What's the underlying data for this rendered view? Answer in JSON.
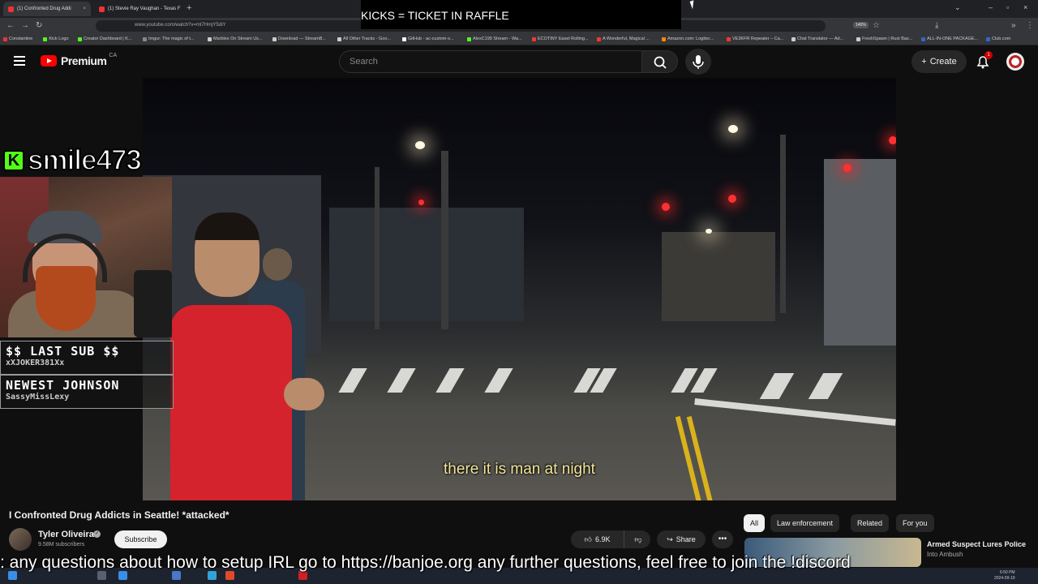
{
  "browser": {
    "tabs": [
      {
        "label": "(1) Confronted Drug Addi",
        "active": true
      },
      {
        "label": "(1) Stevie Ray Vaughan - Texas F",
        "active": false
      }
    ],
    "new_tab_glyph": "+",
    "url": "www.youtube.com/watch?v=mt7HmjY5diY",
    "zoom": "140%",
    "bookmarks": [
      "Constantine",
      "Kick Logo",
      "Creator Dashboard | K...",
      "Imgur: The magic of t...",
      "Marbles On Stream Us...",
      "Download — StreamB...",
      "All Other Tracks - Goo...",
      "GitHub - ac-custom-s...",
      "AlexC199 Stream - Wa...",
      "ECOTINY Easel Rolling...",
      "A Wonderful, Magical ...",
      "Amazon.com: Logitec...",
      "VE3KFR Repeater – Ca...",
      "Chat Translator — Ad...",
      "FreshSpawn | Rust Bas...",
      "ALL-IN-ONE PACKAGE...",
      "Club.com"
    ]
  },
  "stream_overlay": {
    "top_banner": "KICKS = TICKET IN RAFFLE",
    "streamer_name": "smile473",
    "kick_glyph": "K",
    "last_sub_title": "$$ LAST SUB $$",
    "last_sub_name": "xXJOKER381Xx",
    "newest_title": "NEWEST JOHNSON",
    "newest_name": "SassyMissLexy",
    "ticker": ": any questions about how to setup IRL go to https://banjoe.org any further questions, feel free to join the !discord"
  },
  "youtube": {
    "brand": "Premium",
    "country": "CA",
    "search_placeholder": "Search",
    "create_label": "Create",
    "notification_count": "1",
    "caption": "there it is man at night",
    "video_title": "I Confronted Drug Addicts in Seattle! *attacked*",
    "channel_name": "Tyler Oliveira",
    "subscribers": "9.58M subscribers",
    "subscribe_label": "Subscribe",
    "likes": "6.9K",
    "share_label": "Share",
    "chips": [
      "All",
      "Law enforcement",
      "Related",
      "For you"
    ],
    "recommended_title": "Armed Suspect Lures Police",
    "recommended_sub": "Into Ambush"
  },
  "taskbar": {
    "clock_time": "6:50 PM",
    "clock_date": "2024-09-19"
  },
  "colors": {
    "yt_red": "#ff0000",
    "kick_green": "#53fc18",
    "caption_yellow": "#f2e69a"
  }
}
